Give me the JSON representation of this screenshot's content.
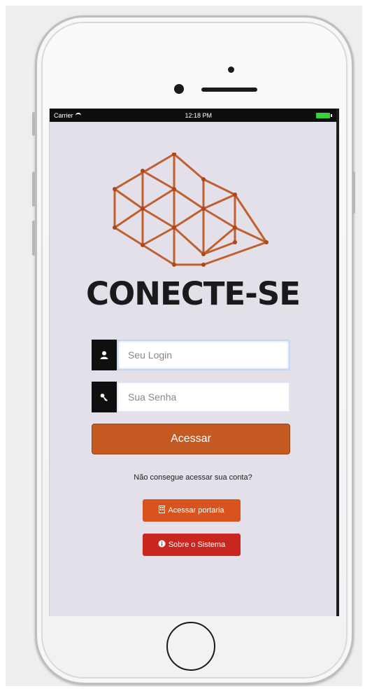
{
  "statusbar": {
    "carrier": "Carrier",
    "time": "12:18 PM"
  },
  "brand": {
    "name": "CONECTE-SE",
    "accent": "#c06030"
  },
  "login": {
    "login_placeholder": "Seu Login",
    "password_placeholder": "Sua Senha",
    "submit_label": "Acessar",
    "help_text": "Não consegue acessar sua conta?"
  },
  "links": {
    "portaria_label": "Acessar portaria",
    "sobre_label": "Sobre o Sistema"
  },
  "icons": {
    "login": "user-icon",
    "password": "key-icon",
    "portaria": "building-icon",
    "sobre": "info-icon"
  },
  "colors": {
    "screen_bg": "#e3e0ea",
    "primary_button": "#c45a22",
    "portaria_button": "#d9531e",
    "sobre_button": "#c9261f"
  }
}
